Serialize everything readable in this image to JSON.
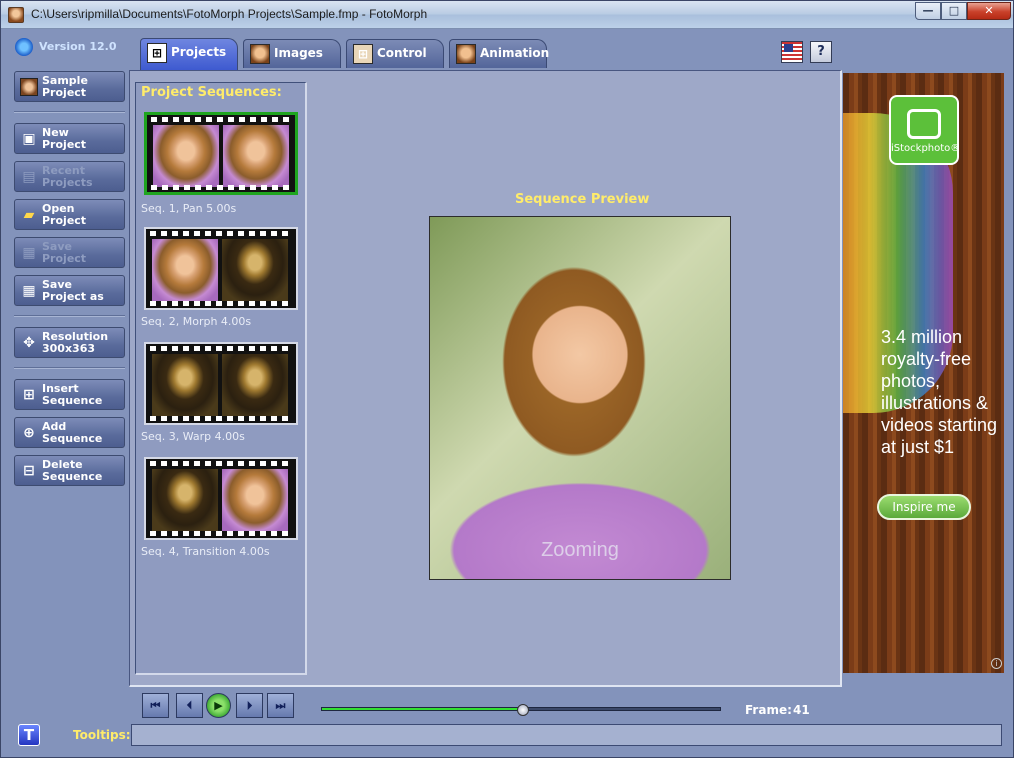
{
  "window": {
    "title": "C:\\Users\\ripmilla\\Documents\\FotoMorph Projects\\Sample.fmp - FotoMorph",
    "minimize": "—",
    "maximize": "□",
    "close": "✕"
  },
  "app": {
    "version": "Version 12.0"
  },
  "sidebar": {
    "items": [
      {
        "label1": "Sample",
        "label2": "Project",
        "icon": "portrait-icon",
        "enabled": true
      },
      {
        "label1": "New",
        "label2": "Project",
        "icon": "new-project-icon",
        "enabled": true
      },
      {
        "label1": "Recent",
        "label2": "Projects",
        "icon": "recent-projects-icon",
        "enabled": false
      },
      {
        "label1": "Open",
        "label2": "Project",
        "icon": "open-folder-icon",
        "enabled": true
      },
      {
        "label1": "Save",
        "label2": "Project",
        "icon": "save-disk-icon",
        "enabled": false
      },
      {
        "label1": "Save",
        "label2": "Project as",
        "icon": "save-as-icon",
        "enabled": true
      },
      {
        "label1": "Resolution",
        "label2": "300x363",
        "icon": "move-arrows-icon",
        "enabled": true
      },
      {
        "label1": "Insert",
        "label2": "Sequence",
        "icon": "insert-sequence-icon",
        "enabled": true
      },
      {
        "label1": "Add",
        "label2": "Sequence",
        "icon": "add-sequence-icon",
        "enabled": true
      },
      {
        "label1": "Delete",
        "label2": "Sequence",
        "icon": "delete-sequence-icon",
        "enabled": true
      }
    ]
  },
  "tabs": [
    {
      "label": "Projects",
      "active": true
    },
    {
      "label": "Images",
      "active": false
    },
    {
      "label": "Control",
      "active": false
    },
    {
      "label": "Animation",
      "active": false
    }
  ],
  "topright": {
    "help": "?"
  },
  "sequences": {
    "title": "Project Sequences:",
    "items": [
      {
        "label": "Seq. 1,  Pan 5.00s",
        "selected": true
      },
      {
        "label": "Seq. 2,  Morph 4.00s",
        "selected": false
      },
      {
        "label": "Seq. 3,  Warp 4.00s",
        "selected": false
      },
      {
        "label": "Seq. 4,  Transition 4.00s",
        "selected": false
      }
    ]
  },
  "preview": {
    "title": "Sequence Preview",
    "caption": "Zooming"
  },
  "ad": {
    "brand": "iStockphoto®",
    "text": "3.4 million royalty-free photos, illustrations & videos starting at just $1",
    "button": "Inspire me",
    "info": "i"
  },
  "playback": {
    "first": "⏮",
    "prev": "⏴",
    "play": "▶",
    "next": "⏵",
    "last": "⏭",
    "frame_label": "Frame:",
    "frame_value": "41",
    "progress": 0.505
  },
  "tooltips": {
    "label": "Tooltips:",
    "button": "T",
    "text": ""
  }
}
